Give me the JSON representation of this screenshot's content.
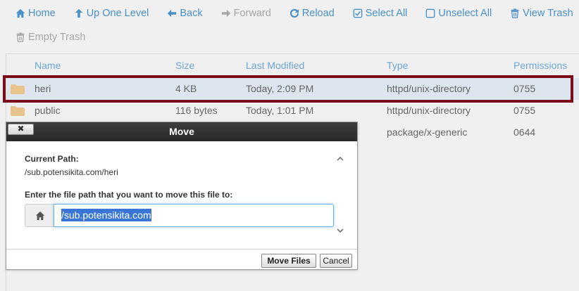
{
  "toolbar": {
    "row1": [
      {
        "label": "Home",
        "icon": "home-icon",
        "disabled": false
      },
      {
        "label": "Up One Level",
        "icon": "arrow-up-icon",
        "disabled": false
      },
      {
        "label": "Back",
        "icon": "arrow-left-icon",
        "disabled": false
      },
      {
        "label": "Forward",
        "icon": "arrow-right-icon",
        "disabled": true
      },
      {
        "label": "Reload",
        "icon": "reload-icon",
        "disabled": false
      },
      {
        "label": "Select All",
        "icon": "checkbox-checked-icon",
        "disabled": false
      },
      {
        "label": "Unselect All",
        "icon": "checkbox-empty-icon",
        "disabled": false
      },
      {
        "label": "View Trash",
        "icon": "trash-icon",
        "disabled": false
      }
    ],
    "row2": [
      {
        "label": "Empty Trash",
        "icon": "trash-icon",
        "disabled": true
      }
    ]
  },
  "columns": {
    "name": "Name",
    "size": "Size",
    "modified": "Last Modified",
    "type": "Type",
    "permissions": "Permissions"
  },
  "files": [
    {
      "name": "heri",
      "size": "4 KB",
      "modified": "Today, 2:09 PM",
      "type": "httpd/unix-directory",
      "permissions": "0755",
      "selected": true
    },
    {
      "name": "public",
      "size": "116 bytes",
      "modified": "Today, 1:01 PM",
      "type": "httpd/unix-directory",
      "permissions": "0755",
      "selected": false
    },
    {
      "name": "",
      "size": "",
      "modified": "",
      "type": "package/x-generic",
      "permissions": "0644",
      "selected": false
    }
  ],
  "dialog": {
    "title": "Move",
    "close_label": "✖",
    "current_path_label": "Current Path:",
    "current_path": "/sub.potensikita.com/heri",
    "target_label": "Enter the file path that you want to move this file to:",
    "target_value": "/sub.potensikita.com",
    "move_button": "Move Files",
    "cancel_button": "Cancel"
  },
  "colors": {
    "link": "#4a90c8",
    "highlight_border": "#7a0e1b",
    "folder": "#e8c48a"
  }
}
